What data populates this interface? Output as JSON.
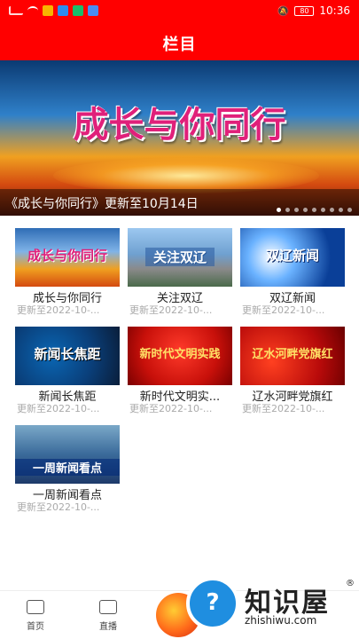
{
  "status_bar": {
    "battery": "80",
    "time": "10:36"
  },
  "header": {
    "title": "栏目"
  },
  "banner": {
    "art_text": "成长与你同行",
    "caption": "《成长与你同行》更新至10月14日",
    "dots_total": 9,
    "active_dot": 0
  },
  "columns": [
    {
      "title": "成长与你同行",
      "subtitle": "更新至2022-10-...",
      "thumb_text": "成长与你同行"
    },
    {
      "title": "关注双辽",
      "subtitle": "更新至2022-10-...",
      "thumb_text": "关注双辽"
    },
    {
      "title": "双辽新闻",
      "subtitle": "更新至2022-10-...",
      "thumb_text": "双辽新闻"
    },
    {
      "title": "新闻长焦距",
      "subtitle": "更新至2022-10-...",
      "thumb_text": "新闻长焦距"
    },
    {
      "title": "新时代文明实...",
      "subtitle": "更新至2022-10-...",
      "thumb_text": "新时代文明实践"
    },
    {
      "title": "辽水河畔党旗红",
      "subtitle": "更新至2022-10-...",
      "thumb_text": "辽水河畔党旗红"
    },
    {
      "title": "一周新闻看点",
      "subtitle": "更新至2022-10-...",
      "thumb_text": "一周新闻看点"
    }
  ],
  "bottom_nav": {
    "home_label": "首页",
    "live_label": "直播"
  },
  "watermark": {
    "text": "知识屋",
    "domain": "zhishiwu.com",
    "reg": "®",
    "glyph": "?"
  },
  "colors": {
    "brand_red": "#ff0000"
  }
}
